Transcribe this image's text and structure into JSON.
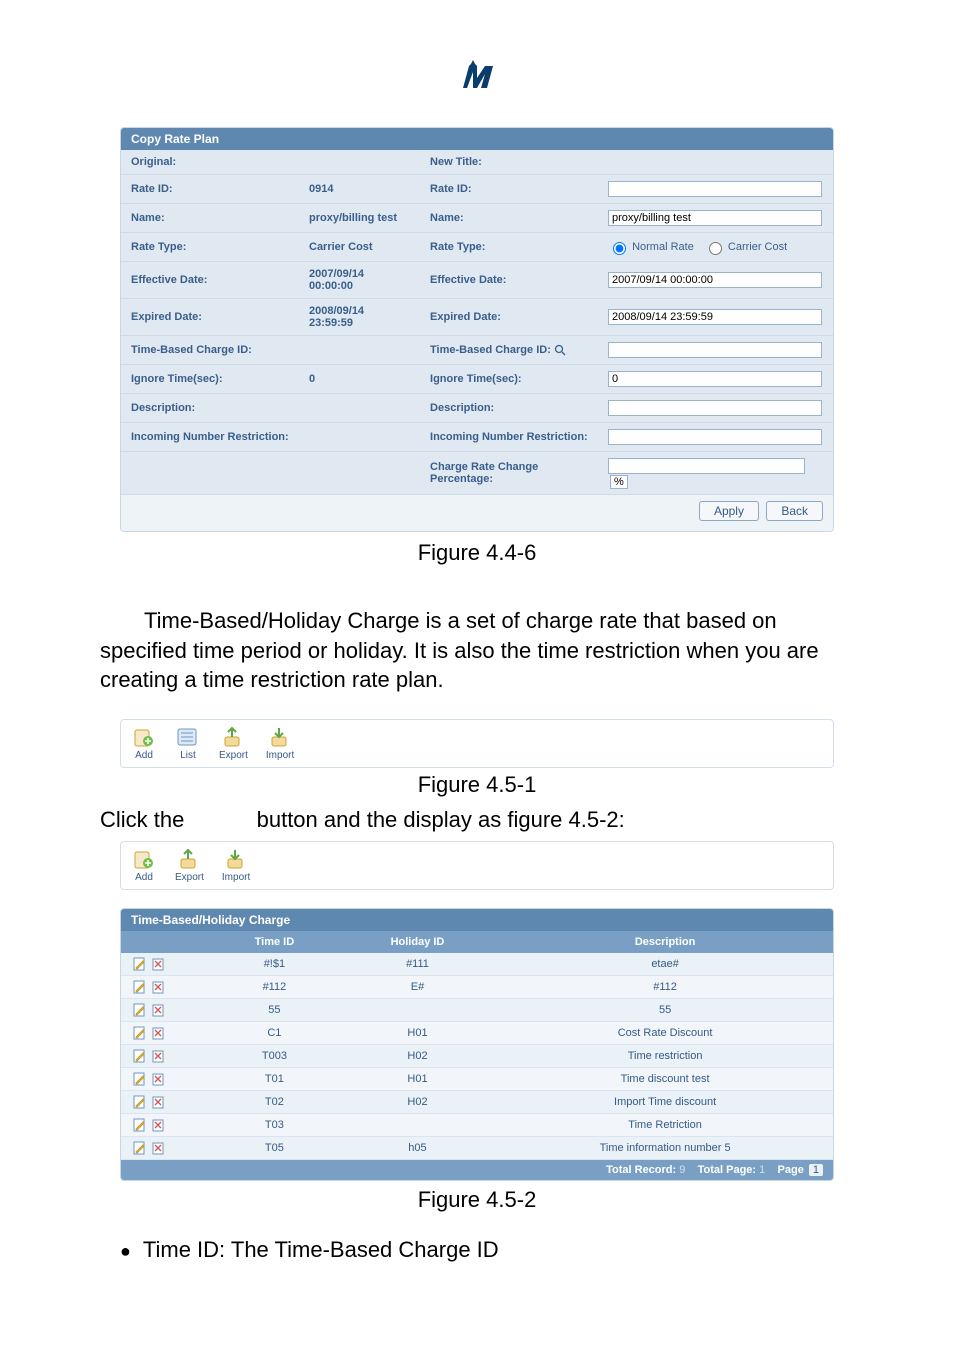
{
  "logo_text": "Im",
  "copy_rate_plan": {
    "header": "Copy Rate Plan",
    "rows": [
      {
        "orig_label": "Original:",
        "orig_value": "",
        "new_label": "New Title:",
        "new_input": "",
        "type": "text"
      },
      {
        "orig_label": "Rate ID:",
        "orig_value": "0914",
        "new_label": "Rate ID:",
        "new_input": "",
        "type": "text"
      },
      {
        "orig_label": "Name:",
        "orig_value": "proxy/billing test",
        "new_label": "Name:",
        "new_input": "proxy/billing test",
        "type": "text"
      },
      {
        "orig_label": "Rate Type:",
        "orig_value": "Carrier Cost",
        "new_label": "Rate Type:",
        "new_input": "",
        "type": "radio"
      },
      {
        "orig_label": "Effective Date:",
        "orig_value": "2007/09/14 00:00:00",
        "new_label": "Effective Date:",
        "new_input": "2007/09/14 00:00:00",
        "type": "text"
      },
      {
        "orig_label": "Expired Date:",
        "orig_value": "2008/09/14 23:59:59",
        "new_label": "Expired Date:",
        "new_input": "2008/09/14 23:59:59",
        "type": "text"
      },
      {
        "orig_label": "Time-Based Charge ID:",
        "orig_value": "",
        "new_label": "Time-Based Charge ID:",
        "new_input": "",
        "type": "text_mag"
      },
      {
        "orig_label": "Ignore Time(sec):",
        "orig_value": "0",
        "new_label": "Ignore Time(sec):",
        "new_input": "0",
        "type": "text"
      },
      {
        "orig_label": "Description:",
        "orig_value": "",
        "new_label": "Description:",
        "new_input": "",
        "type": "text"
      },
      {
        "orig_label": "Incoming Number Restriction:",
        "orig_value": "",
        "new_label": "Incoming Number Restriction:",
        "new_input": "",
        "type": "text"
      },
      {
        "orig_label": "",
        "orig_value": "",
        "new_label": "Charge Rate Change Percentage:",
        "new_input": "",
        "type": "text_pct"
      }
    ],
    "radio_options": {
      "a": "Normal Rate",
      "b": "Carrier Cost"
    },
    "pct_suffix": "%",
    "apply": "Apply",
    "back": "Back"
  },
  "fig_4_4_6": "Figure 4.4-6",
  "paragraph_1": "Time-Based/Holiday Charge is a set of charge rate that based on specified time period or holiday. It is also the time restriction when you are creating a time restriction rate plan.",
  "toolbar_a": [
    {
      "label": "Add"
    },
    {
      "label": "List"
    },
    {
      "label": "Export"
    },
    {
      "label": "Import"
    }
  ],
  "fig_4_5_1": "Figure 4.5-1",
  "click_line_pre": "Click the",
  "click_line_post": "button and the display as figure 4.5-2:",
  "toolbar_b": [
    {
      "label": "Add"
    },
    {
      "label": "Export"
    },
    {
      "label": "Import"
    }
  ],
  "tbhc": {
    "header": "Time-Based/Holiday Charge",
    "col_actions": "",
    "col_time": "Time ID",
    "col_holiday": "Holiday ID",
    "col_desc": "Description",
    "rows": [
      {
        "time": "#!$1",
        "holiday": "#111",
        "desc": "etae#"
      },
      {
        "time": "#112",
        "holiday": "E#",
        "desc": "#112"
      },
      {
        "time": "55",
        "holiday": "",
        "desc": "55"
      },
      {
        "time": "C1",
        "holiday": "H01",
        "desc": "Cost Rate Discount"
      },
      {
        "time": "T003",
        "holiday": "H02",
        "desc": "Time restriction"
      },
      {
        "time": "T01",
        "holiday": "H01",
        "desc": "Time discount test"
      },
      {
        "time": "T02",
        "holiday": "H02",
        "desc": "Import Time discount"
      },
      {
        "time": "T03",
        "holiday": "",
        "desc": "Time Retriction"
      },
      {
        "time": "T05",
        "holiday": "h05",
        "desc": "Time information number 5"
      }
    ],
    "footer_total_record_label": "Total Record:",
    "footer_total_record_value": "9",
    "footer_total_page_label": "Total Page:",
    "footer_total_page_value": "1",
    "footer_page_label": "Page",
    "footer_page_value": "1"
  },
  "fig_4_5_2": "Figure 4.5-2",
  "bullet_1": "Time ID: The Time-Based Charge ID"
}
